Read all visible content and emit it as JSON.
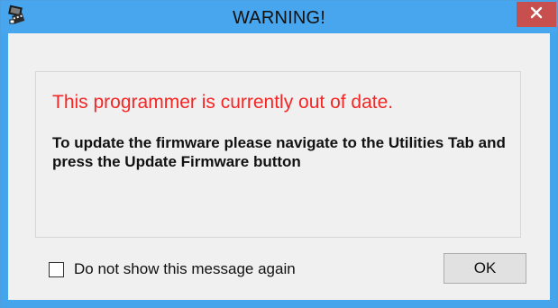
{
  "window": {
    "title": "WARNING!",
    "icons": {
      "app": "programmer-chip-icon",
      "close": "close-icon"
    },
    "colors": {
      "titlebar": "#48a6ee",
      "close_button": "#c7504f",
      "warning_text": "#f42626"
    }
  },
  "message": {
    "warning": "This programmer is currently out of date.",
    "detail": "To update the firmware please navigate to the Utilities Tab and press the Update Firmware button"
  },
  "footer": {
    "checkbox_label": "Do not show this message again",
    "checkbox_checked": false,
    "ok_label": "OK"
  }
}
